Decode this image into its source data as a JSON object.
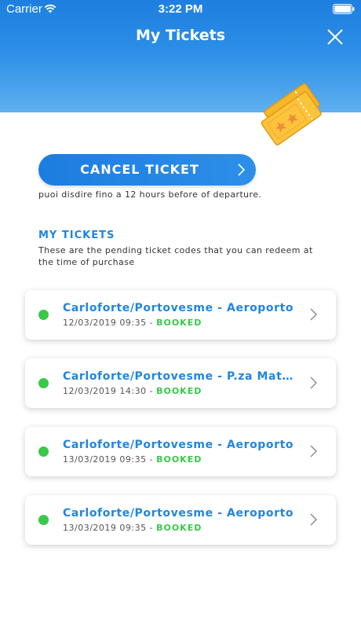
{
  "status_bar": {
    "carrier": "Carrier",
    "time": "3:22 PM"
  },
  "header": {
    "title": "My Tickets"
  },
  "cancel": {
    "button_label": "CANCEL TICKET",
    "note": "puoi disdire fino a  12 hours before of departure."
  },
  "section": {
    "title": "MY TICKETS",
    "subtitle": "These are the pending ticket codes that you can redeem at the time of purchase"
  },
  "colors": {
    "accent": "#1f86e0",
    "status_green": "#39c84a"
  },
  "tickets": [
    {
      "route": "Carloforte/Portovesme - Aeroporto",
      "datetime": "12/03/2019 09:35",
      "separator": "-",
      "status": "BOOKED"
    },
    {
      "route": "Carloforte/Portovesme - P.za Matteotti",
      "datetime": "12/03/2019 14:30",
      "separator": "-",
      "status": "BOOKED"
    },
    {
      "route": "Carloforte/Portovesme - Aeroporto",
      "datetime": "13/03/2019 09:35",
      "separator": "-",
      "status": "BOOKED"
    },
    {
      "route": "Carloforte/Portovesme - Aeroporto",
      "datetime": "13/03/2019 09:35",
      "separator": "-",
      "status": "BOOKED"
    }
  ]
}
